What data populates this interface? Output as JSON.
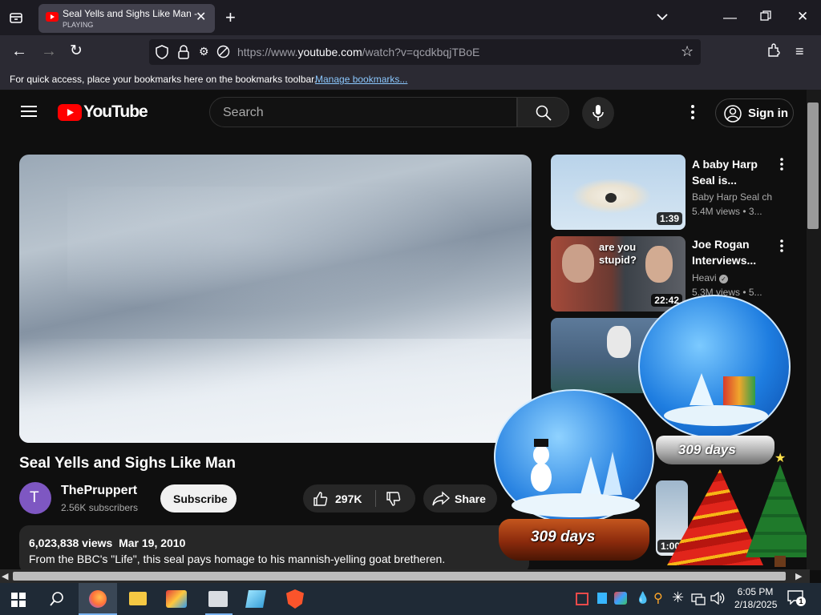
{
  "browser": {
    "tab_title": "Seal Yells and Sighs Like Man -",
    "tab_status": "PLAYING",
    "url_prefix": "https://www.",
    "url_domain": "youtube.com",
    "url_path": "/watch?v=qcdkbqjTBoE",
    "bookmarks_text": "For quick access, place your bookmarks here on the bookmarks toolbar.",
    "bookmarks_link": "Manage bookmarks..."
  },
  "youtube": {
    "logo_text": "YouTube",
    "search_placeholder": "Search",
    "sign_in": "Sign in",
    "video_title": "Seal Yells and Sighs Like Man",
    "channel_initial": "T",
    "channel_name": "ThePruppert",
    "subscribers": "2.56K subscribers",
    "subscribe": "Subscribe",
    "likes": "297K",
    "share": "Share",
    "views": "6,023,838 views",
    "date": "Mar 19, 2010",
    "description": "From the BBC's \"Life\", this seal pays homage to his mannish-yelling goat bretheren."
  },
  "recommendations": [
    {
      "title1": "A baby Harp",
      "title2": "Seal is...",
      "channel": "Baby Harp Seal ch",
      "meta": "5.4M views  • 3...",
      "duration": "1:39"
    },
    {
      "title1": "Joe Rogan",
      "title2": "Interviews...",
      "channel": "Heavi",
      "meta": "5.3M views  • 5...",
      "duration": "22:42",
      "thumb_text1": "are you",
      "thumb_text2": "stupid?"
    },
    {
      "duration": "1:00"
    }
  ],
  "overlay": {
    "globe1_label": "309 days",
    "globe2_label": "309 days"
  },
  "taskbar": {
    "time": "6:05 PM",
    "date": "2/18/2025",
    "notif_count": "1"
  },
  "colors": {
    "yt_red": "#ff0000",
    "link_blue": "#8bc7fd",
    "avatar_purple": "#7e57c2",
    "taskbar": "#1f2a36"
  }
}
